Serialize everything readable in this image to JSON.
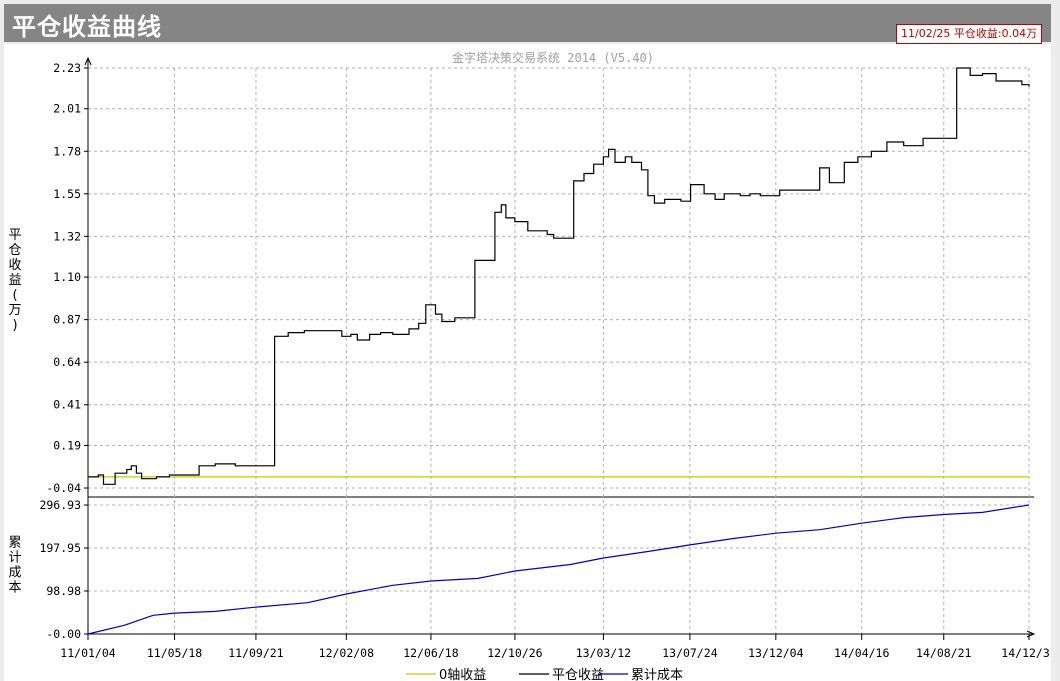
{
  "page_title": "平仓收益曲线",
  "status_readout": "11/02/25 平仓收益:0.04万",
  "colors": {
    "zero_axis": "#c8c800",
    "profit": "#000000",
    "cost": "#0000c8",
    "grid": "#b4b4b4"
  },
  "chart_data": [
    {
      "type": "line",
      "title": "金字塔决策交易系统 2014 (V5.40)",
      "ylabel": "平仓收益(万)",
      "ylim": [
        -0.04,
        2.23
      ],
      "yticks": [
        "2.23",
        "2.01",
        "1.78",
        "1.55",
        "1.32",
        "1.10",
        "0.87",
        "0.64",
        "0.41",
        "0.19",
        "-0.04"
      ],
      "x_dates": [
        "11/01/04",
        "11/05/18",
        "11/09/21",
        "12/02/08",
        "12/06/18",
        "12/10/26",
        "13/03/12",
        "13/07/24",
        "13/12/04",
        "14/04/16",
        "14/08/21",
        "14/12/31"
      ],
      "grid": true,
      "series": [
        {
          "name": "0轴收益",
          "points": [
            [
              "11/01/04",
              0.02
            ],
            [
              "14/12/31",
              0.02
            ]
          ]
        },
        {
          "name": "平仓收益",
          "step": true,
          "points": [
            [
              "11/01/04",
              0.02
            ],
            [
              "11/01/20",
              0.03
            ],
            [
              "11/01/28",
              -0.02
            ],
            [
              "11/02/15",
              0.04
            ],
            [
              "11/02/25",
              0.04
            ],
            [
              "11/03/05",
              0.06
            ],
            [
              "11/03/12",
              0.08
            ],
            [
              "11/03/20",
              0.04
            ],
            [
              "11/03/28",
              0.01
            ],
            [
              "11/04/20",
              0.02
            ],
            [
              "11/05/10",
              0.03
            ],
            [
              "11/06/20",
              0.03
            ],
            [
              "11/06/25",
              0.08
            ],
            [
              "11/07/20",
              0.09
            ],
            [
              "11/08/20",
              0.08
            ],
            [
              "11/09/10",
              0.08
            ],
            [
              "11/10/15",
              0.08
            ],
            [
              "11/10/20",
              0.78
            ],
            [
              "11/11/10",
              0.8
            ],
            [
              "11/12/05",
              0.81
            ],
            [
              "12/02/01",
              0.78
            ],
            [
              "12/02/15",
              0.79
            ],
            [
              "12/02/25",
              0.76
            ],
            [
              "12/03/15",
              0.79
            ],
            [
              "12/04/01",
              0.8
            ],
            [
              "12/04/20",
              0.79
            ],
            [
              "12/05/15",
              0.82
            ],
            [
              "12/05/30",
              0.85
            ],
            [
              "12/06/10",
              0.95
            ],
            [
              "12/06/25",
              0.9
            ],
            [
              "12/07/05",
              0.86
            ],
            [
              "12/07/25",
              0.88
            ],
            [
              "12/08/25",
              1.19
            ],
            [
              "12/09/25",
              1.45
            ],
            [
              "12/10/05",
              1.49
            ],
            [
              "12/10/12",
              1.42
            ],
            [
              "12/10/26",
              1.4
            ],
            [
              "12/11/15",
              1.35
            ],
            [
              "12/12/15",
              1.33
            ],
            [
              "12/12/25",
              1.31
            ],
            [
              "13/01/25",
              1.62
            ],
            [
              "13/02/10",
              1.66
            ],
            [
              "13/02/25",
              1.71
            ],
            [
              "13/03/12",
              1.75
            ],
            [
              "13/03/20",
              1.79
            ],
            [
              "13/03/30",
              1.72
            ],
            [
              "13/04/15",
              1.75
            ],
            [
              "13/04/25",
              1.72
            ],
            [
              "13/05/10",
              1.68
            ],
            [
              "13/05/20",
              1.54
            ],
            [
              "13/05/30",
              1.5
            ],
            [
              "13/06/15",
              1.52
            ],
            [
              "13/07/10",
              1.51
            ],
            [
              "13/07/25",
              1.6
            ],
            [
              "13/08/15",
              1.55
            ],
            [
              "13/09/01",
              1.52
            ],
            [
              "13/09/15",
              1.55
            ],
            [
              "13/10/10",
              1.54
            ],
            [
              "13/10/25",
              1.55
            ],
            [
              "13/11/10",
              1.54
            ],
            [
              "13/12/10",
              1.57
            ],
            [
              "14/02/10",
              1.69
            ],
            [
              "14/02/25",
              1.61
            ],
            [
              "14/03/20",
              1.72
            ],
            [
              "14/04/10",
              1.75
            ],
            [
              "14/05/01",
              1.78
            ],
            [
              "14/05/25",
              1.83
            ],
            [
              "14/06/20",
              1.81
            ],
            [
              "14/07/20",
              1.85
            ],
            [
              "14/09/10",
              2.23
            ],
            [
              "14/10/01",
              2.19
            ],
            [
              "14/10/20",
              2.2
            ],
            [
              "14/11/10",
              2.16
            ],
            [
              "14/12/20",
              2.14
            ],
            [
              "14/12/31",
              2.13
            ]
          ]
        }
      ]
    },
    {
      "type": "line",
      "ylabel": "累计成本",
      "ylim": [
        -0.0,
        296.93
      ],
      "yticks": [
        "296.93",
        "197.95",
        "98.98",
        "-0.00"
      ],
      "x_dates": [
        "11/01/04",
        "11/05/18",
        "11/09/21",
        "12/02/08",
        "12/06/18",
        "12/10/26",
        "13/03/12",
        "13/07/24",
        "13/12/04",
        "14/04/16",
        "14/08/21",
        "14/12/31"
      ],
      "grid": true,
      "series": [
        {
          "name": "累计成本",
          "points": [
            [
              "11/01/04",
              0
            ],
            [
              "11/03/01",
              20
            ],
            [
              "11/04/15",
              43
            ],
            [
              "11/05/18",
              48
            ],
            [
              "11/07/20",
              52
            ],
            [
              "11/09/21",
              62
            ],
            [
              "11/12/10",
              72
            ],
            [
              "12/02/08",
              92
            ],
            [
              "12/04/20",
              112
            ],
            [
              "12/06/18",
              122
            ],
            [
              "12/08/30",
              128
            ],
            [
              "12/10/26",
              145
            ],
            [
              "13/01/20",
              160
            ],
            [
              "13/03/12",
              175
            ],
            [
              "13/05/20",
              190
            ],
            [
              "13/07/24",
              205
            ],
            [
              "13/10/01",
              220
            ],
            [
              "13/12/04",
              232
            ],
            [
              "14/02/10",
              240
            ],
            [
              "14/04/16",
              255
            ],
            [
              "14/06/20",
              268
            ],
            [
              "14/08/21",
              275
            ],
            [
              "14/10/20",
              280
            ],
            [
              "14/12/31",
              296.93
            ]
          ]
        }
      ]
    }
  ],
  "legend": [
    "0轴收益",
    "平仓收益",
    "累计成本"
  ]
}
